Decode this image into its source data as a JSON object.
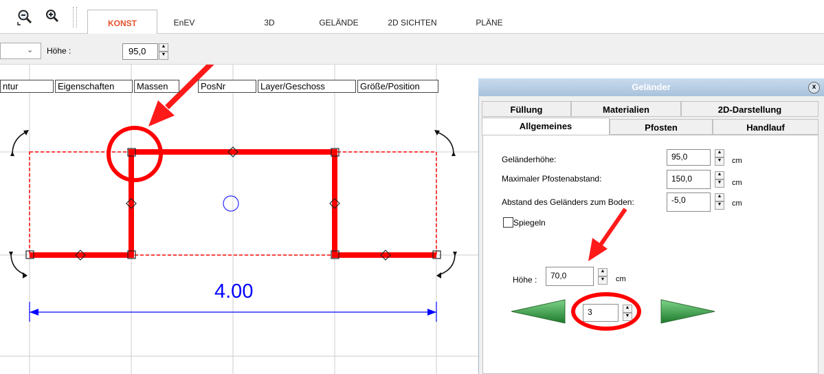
{
  "ribbon": {
    "tabs": [
      "KONST",
      "EnEV",
      "3D",
      "GELÄNDE",
      "2D SICHTEN",
      "PLÄNE"
    ],
    "active_tab": "KONST",
    "accent_color": "#e8512a"
  },
  "toolbar": {
    "hoehe_label": "Höhe :",
    "hoehe_value": "95,0"
  },
  "canvas_tabs": [
    "ntur",
    "Eigenschaften",
    "Massen",
    "PosNr",
    "Layer/Geschoss",
    "Größe/Position"
  ],
  "drawing": {
    "dimension_text": "4.00",
    "railing_color": "#ff0000",
    "dimension_color": "#0000ff"
  },
  "dialog": {
    "title": "Geländer",
    "tabs_row1": [
      "Füllung",
      "Materialien",
      "2D-Darstellung"
    ],
    "tabs_row2": [
      "Allgemeines",
      "Pfosten",
      "Handlauf"
    ],
    "active_tab": "Allgemeines",
    "fields": [
      {
        "label": "Geländerhöhe:",
        "value": "95,0",
        "unit": "cm"
      },
      {
        "label": "Maximaler Pfostenabstand:",
        "value": "150,0",
        "unit": "cm"
      },
      {
        "label": "Abstand des Geländers zum Boden:",
        "value": "-5,0",
        "unit": "cm"
      }
    ],
    "mirror_checkbox": {
      "label": "Spiegeln",
      "checked": false
    },
    "height": {
      "label": "Höhe :",
      "value": "70,0",
      "unit": "cm"
    },
    "segment_index": "3"
  }
}
